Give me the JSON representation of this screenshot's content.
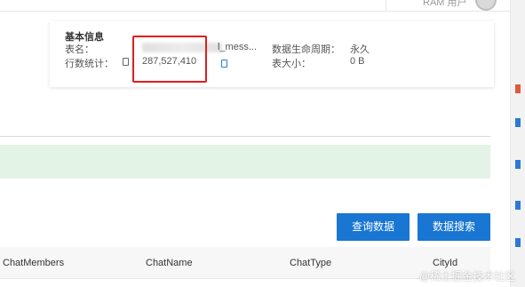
{
  "topbar": {
    "user_label": "RAM 用户"
  },
  "basic_info": {
    "title": "基本信息",
    "table_name_label": "表名：",
    "table_name_suffix": "l_mess...",
    "row_count_label": "行数统计：",
    "row_count_value": "287,527,410",
    "lifecycle_label": "数据生命周期：",
    "lifecycle_value": "永久",
    "table_size_label": "表大小：",
    "table_size_value": "0 B"
  },
  "actions": {
    "query_label": "查询数据",
    "search_label": "数据搜索"
  },
  "table": {
    "columns": [
      "ChatMembers",
      "ChatName",
      "ChatType",
      "CityId"
    ]
  },
  "watermark": "@稀土掘金技术社区",
  "colors": {
    "primary": "#1976d2",
    "highlight": "#e01e1e",
    "banner": "#e3f4e6"
  }
}
